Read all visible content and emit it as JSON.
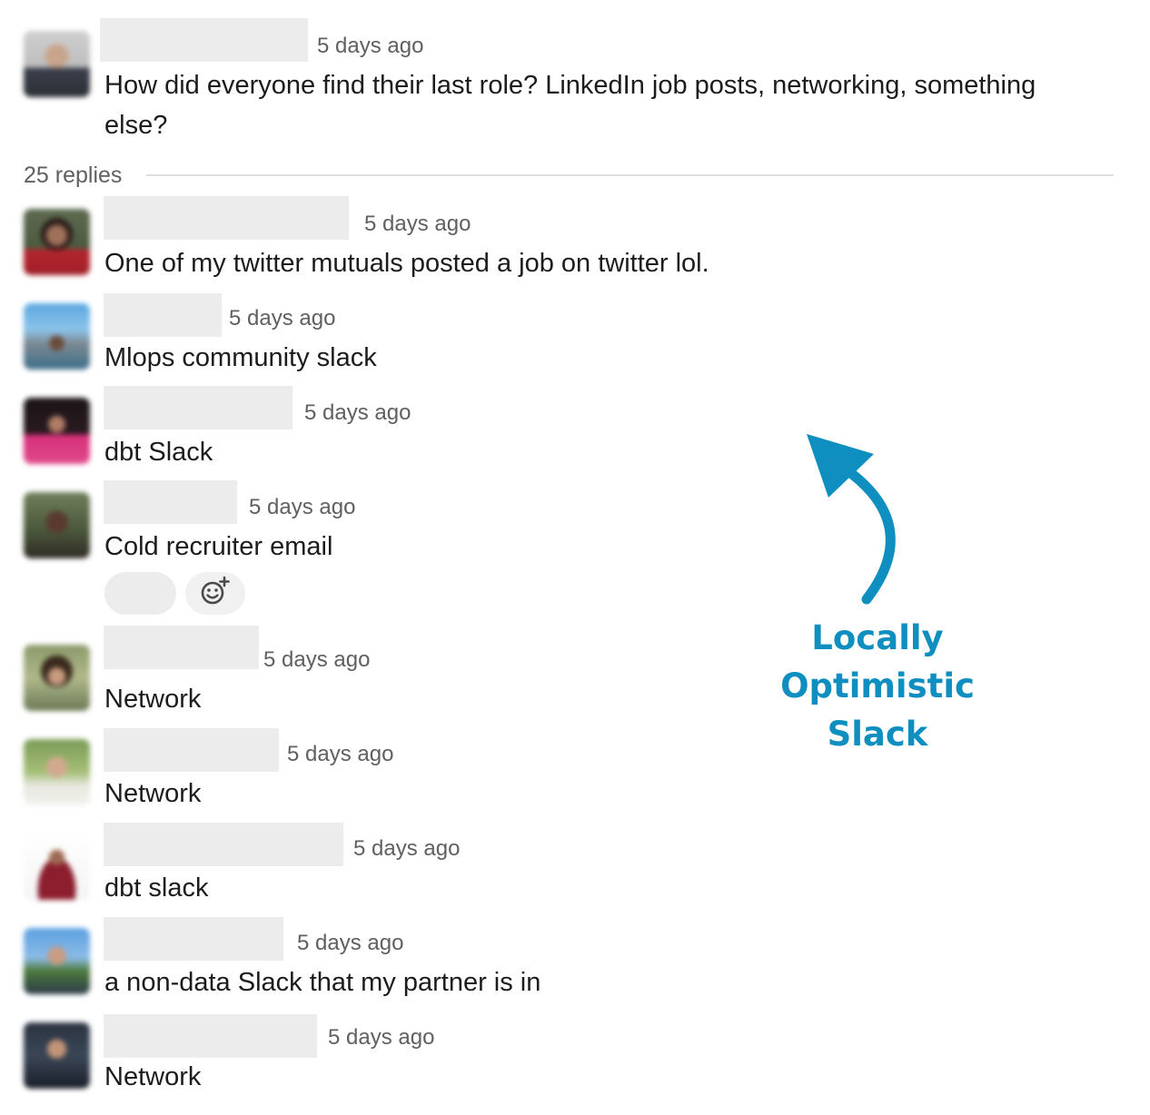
{
  "thread": {
    "parent": {
      "time": "5 days ago",
      "text_line1": "How did everyone find their last role? LinkedIn job posts, networking, something",
      "text_line2": "else?"
    },
    "replies_label": "25 replies",
    "replies": [
      {
        "time": "5 days ago",
        "text": "One of my twitter mutuals posted a job on twitter lol."
      },
      {
        "time": "5 days ago",
        "text": "Mlops community slack"
      },
      {
        "time": "5 days ago",
        "text": "dbt Slack"
      },
      {
        "time": "5 days ago",
        "text": "Cold recruiter email"
      },
      {
        "time": "5 days ago",
        "text": "Network"
      },
      {
        "time": "5 days ago",
        "text": "Network"
      },
      {
        "time": "5 days ago",
        "text": "dbt slack"
      },
      {
        "time": "5 days ago",
        "text": "a non-data Slack that my partner is in"
      },
      {
        "time": "5 days ago",
        "text": "Network"
      }
    ]
  },
  "annotation": {
    "line1": "Locally Optimistic",
    "line2": "Slack",
    "color": "#0f8fbf"
  },
  "icons": {
    "add_reaction": "add-reaction-icon",
    "arrow": "curved-arrow-icon"
  }
}
